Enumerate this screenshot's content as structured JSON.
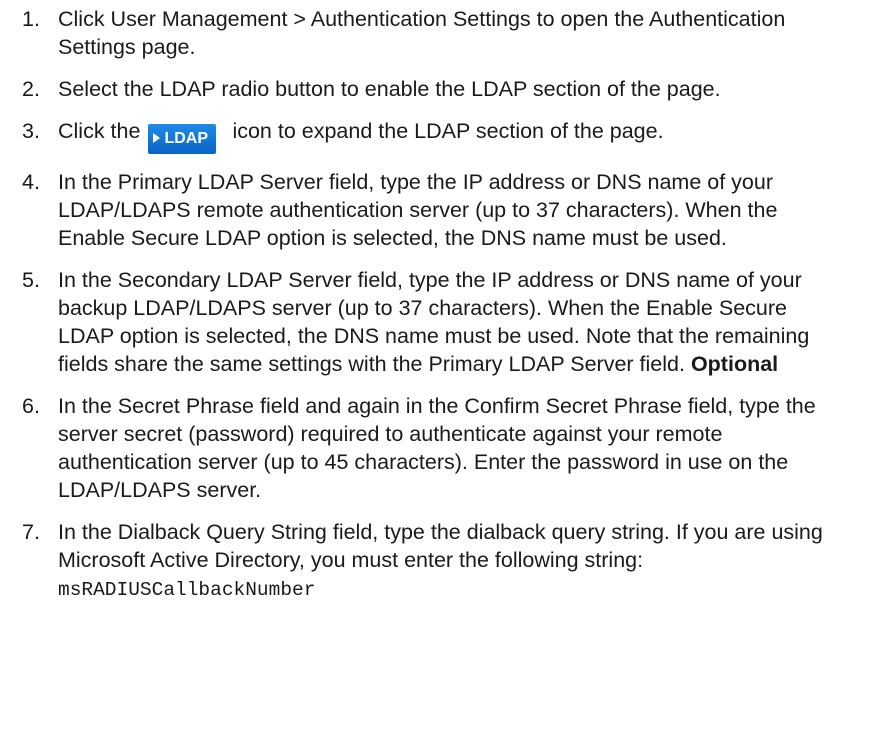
{
  "steps": [
    {
      "number": "1.",
      "text": "Click User Management > Authentication Settings to open the Authentication Settings page."
    },
    {
      "number": "2.",
      "text": "Select the LDAP radio button to enable the LDAP section of the page."
    },
    {
      "number": "3.",
      "before": "Click the",
      "icon_name": "ldap-expand-icon",
      "icon_label": "LDAP",
      "after": "icon to expand the LDAP section of the page."
    },
    {
      "number": "4.",
      "text": "In the Primary LDAP Server field, type the IP address or DNS name of your LDAP/LDAPS remote authentication server (up to 37 characters). When the Enable Secure LDAP option is selected, the DNS name must be used."
    },
    {
      "number": "5.",
      "text": "In the Secondary LDAP Server field, type the IP address or DNS name of your backup LDAP/LDAPS server (up to 37 characters). When the Enable Secure LDAP option is selected, the DNS name must be used. Note that the remaining fields share the same settings with the Primary LDAP Server field.",
      "bold": "Optional"
    },
    {
      "number": "6.",
      "text": "In the Secret Phrase field and again in the Confirm Secret Phrase field, type the server secret (password) required to authenticate against your remote authentication server (up to 45 characters). Enter the password in use on the LDAP/LDAPS server."
    },
    {
      "number": "7.",
      "text": "In the Dialback Query String field, type the dialback query string. If you are using Microsoft Active Directory, you must enter the following string:",
      "code": "msRADIUSCallbackNumber"
    }
  ],
  "colors": {
    "text": "#1a1a1a",
    "icon_background": "#1478d8",
    "icon_text": "#ffffff"
  }
}
